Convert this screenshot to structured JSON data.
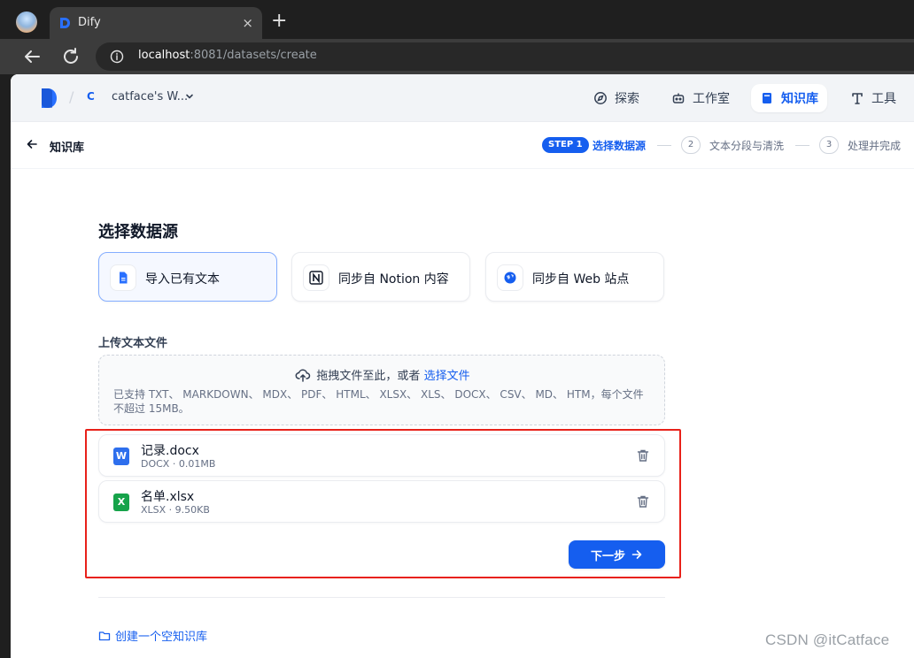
{
  "browser": {
    "tab_title": "Dify",
    "tab_close": "×",
    "new_tab": "+",
    "url_host": "localhost",
    "url_path": ":8081/datasets/create"
  },
  "header": {
    "workspace_avatar": "C",
    "workspace_name": "catface's W...",
    "nav": [
      {
        "label": "探索",
        "icon": "compass-icon",
        "active": false
      },
      {
        "label": "工作室",
        "icon": "robot-icon",
        "active": false
      },
      {
        "label": "知识库",
        "icon": "book-icon",
        "active": true
      },
      {
        "label": "工具",
        "icon": "tool-icon",
        "active": false
      }
    ]
  },
  "stepbar": {
    "breadcrumb": "知识库",
    "step1_badge": "STEP 1",
    "step1_label": "选择数据源",
    "step2_num": "2",
    "step2_label": "文本分段与清洗",
    "step3_num": "3",
    "step3_label": "处理并完成"
  },
  "main": {
    "title": "选择数据源",
    "sources": [
      {
        "label": "导入已有文本",
        "icon": "document-icon",
        "active": true
      },
      {
        "label": "同步自 Notion 内容",
        "icon": "notion-icon",
        "active": false
      },
      {
        "label": "同步自 Web 站点",
        "icon": "globe-icon",
        "active": false
      }
    ],
    "upload_label": "上传文本文件",
    "dropzone": {
      "text": "拖拽文件至此，或者",
      "link": "选择文件",
      "supported": "已支持 TXT、 MARKDOWN、 MDX、 PDF、 HTML、 XLSX、 XLS、 DOCX、 CSV、 MD、 HTM，每个文件不超过 15MB。"
    },
    "files": [
      {
        "name": "记录.docx",
        "meta": "DOCX · 0.01MB",
        "badge": "W",
        "color": "#2e6fed"
      },
      {
        "name": "名单.xlsx",
        "meta": "XLSX · 9.50KB",
        "badge": "X",
        "color": "#16a34a"
      }
    ],
    "next_button": "下一步",
    "create_empty": "创建一个空知识库"
  },
  "watermark": "CSDN @itCatface",
  "colors": {
    "accent": "#155eef",
    "highlight": "#e8211a"
  }
}
